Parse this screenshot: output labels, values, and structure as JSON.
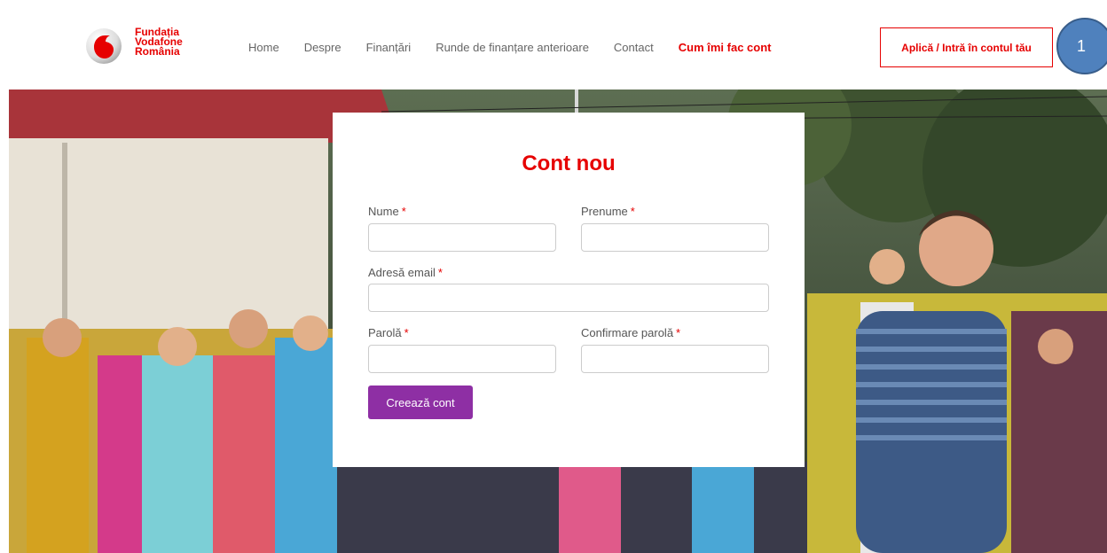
{
  "brand": {
    "name_line1": "Fundația",
    "name_line2": "Vodafone",
    "name_line3": "România",
    "accent_color": "#e60000"
  },
  "nav": {
    "items": [
      {
        "label": "Home"
      },
      {
        "label": "Despre"
      },
      {
        "label": "Finanțări"
      },
      {
        "label": "Runde de finanțare anterioare"
      },
      {
        "label": "Contact"
      },
      {
        "label": "Cum îmi fac cont",
        "active": true
      }
    ]
  },
  "header": {
    "cta_label": "Aplică / Intră în contul tău",
    "marker_label": "1"
  },
  "form": {
    "title": "Cont nou",
    "required_mark": "*",
    "fields": {
      "last_name": {
        "label": "Nume",
        "value": ""
      },
      "first_name": {
        "label": "Prenume",
        "value": ""
      },
      "email": {
        "label": "Adresă email",
        "value": ""
      },
      "password": {
        "label": "Parolă",
        "value": ""
      },
      "password_confirm": {
        "label": "Confirmare parolă",
        "value": ""
      }
    },
    "submit_label": "Creează cont",
    "submit_color": "#8e2fa4"
  },
  "icons": {
    "logo": "vodafone-speechmark-logo"
  }
}
